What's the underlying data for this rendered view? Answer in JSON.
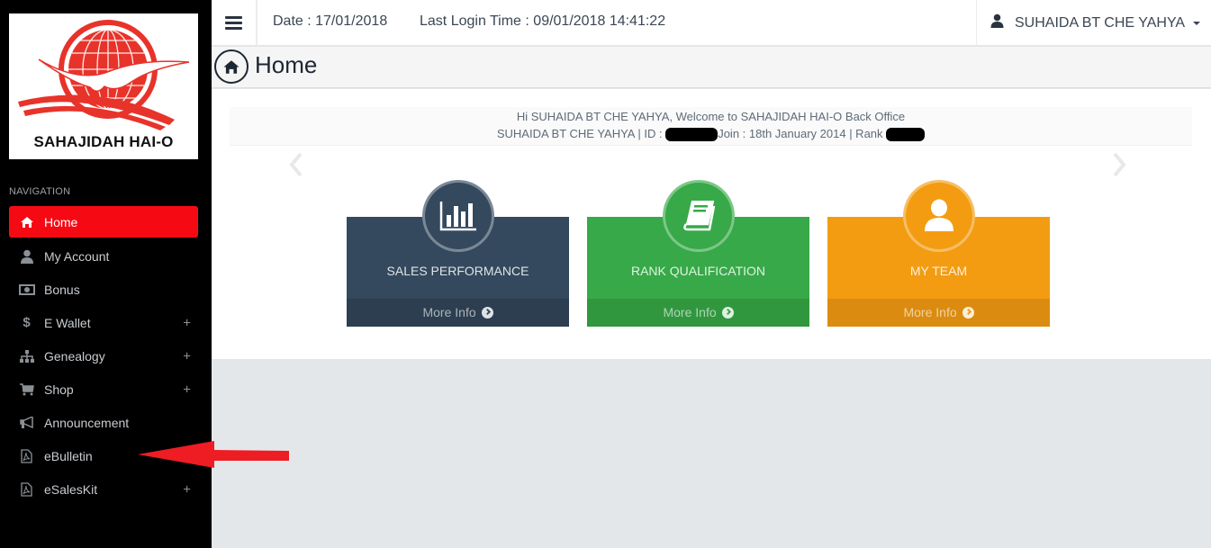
{
  "brand": {
    "logo_text": "SAHAJIDAH HAI-O",
    "accent_color": "#f50a14"
  },
  "sidebar": {
    "heading": "NAVIGATION",
    "items": [
      {
        "label": "Home",
        "icon": "home-icon",
        "active": true,
        "expandable": false
      },
      {
        "label": "My Account",
        "icon": "user-icon",
        "active": false,
        "expandable": false
      },
      {
        "label": "Bonus",
        "icon": "money-icon",
        "active": false,
        "expandable": false
      },
      {
        "label": "E Wallet",
        "icon": "dollar-icon",
        "active": false,
        "expandable": true
      },
      {
        "label": "Genealogy",
        "icon": "sitemap-icon",
        "active": false,
        "expandable": true
      },
      {
        "label": "Shop",
        "icon": "cart-icon",
        "active": false,
        "expandable": true
      },
      {
        "label": "Announcement",
        "icon": "bullhorn-icon",
        "active": false,
        "expandable": false
      },
      {
        "label": "eBulletin",
        "icon": "pdf-file-icon",
        "active": false,
        "expandable": false
      },
      {
        "label": "eSalesKit",
        "icon": "pdf-file-icon",
        "active": false,
        "expandable": true
      }
    ],
    "expand_symbol": "+"
  },
  "topbar": {
    "date": "Date : 17/01/2018",
    "last_login": "Last Login Time : 09/01/2018 14:41:22",
    "user_name": "SUHAIDA BT CHE YAHYA"
  },
  "page": {
    "title": "Home"
  },
  "welcome": {
    "line1": "Hi SUHAIDA BT CHE YAHYA, Welcome to SAHAJIDAH HAI-O Back Office",
    "line2_prefix": "SUHAIDA BT CHE YAHYA | ID : ",
    "line2_join": "Join : 18th January 2014 | Rank "
  },
  "cards": [
    {
      "title": "SALES PERFORMANCE",
      "footer": "More Info",
      "icon": "bar-chart-icon",
      "color": "#34495e",
      "footer_color": "#2c3e50"
    },
    {
      "title": "RANK QUALIFICATION",
      "footer": "More Info",
      "icon": "book-icon",
      "color": "#37a948",
      "footer_color": "#31973f"
    },
    {
      "title": "MY TEAM",
      "footer": "More Info",
      "icon": "user-icon",
      "color": "#f39c12",
      "footer_color": "#db8c10"
    }
  ]
}
